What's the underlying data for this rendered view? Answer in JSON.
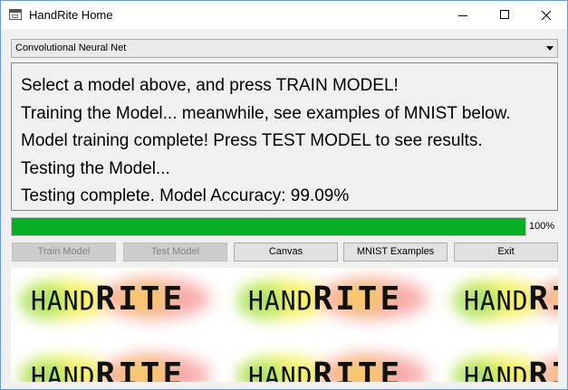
{
  "window": {
    "title": "HandRite Home"
  },
  "model_select": {
    "selected": "Convolutional Neural Net"
  },
  "log": {
    "lines": [
      "Select a model above, and press TRAIN MODEL!",
      "Training the Model... meanwhile, see examples of MNIST below.",
      "Model training complete! Press TEST MODEL to see results.",
      "Testing the Model...",
      "Testing complete. Model Accuracy: 99.09%"
    ]
  },
  "progress": {
    "value": 1.0,
    "label": "100%",
    "color": "#06b025"
  },
  "buttons": {
    "train": "Train Model",
    "test": "Test Model",
    "canvas": "Canvas",
    "mnist": "MNIST Examples",
    "exit": "Exit"
  },
  "banner": {
    "logo_hand": "HAND",
    "logo_rite": "RITE"
  }
}
